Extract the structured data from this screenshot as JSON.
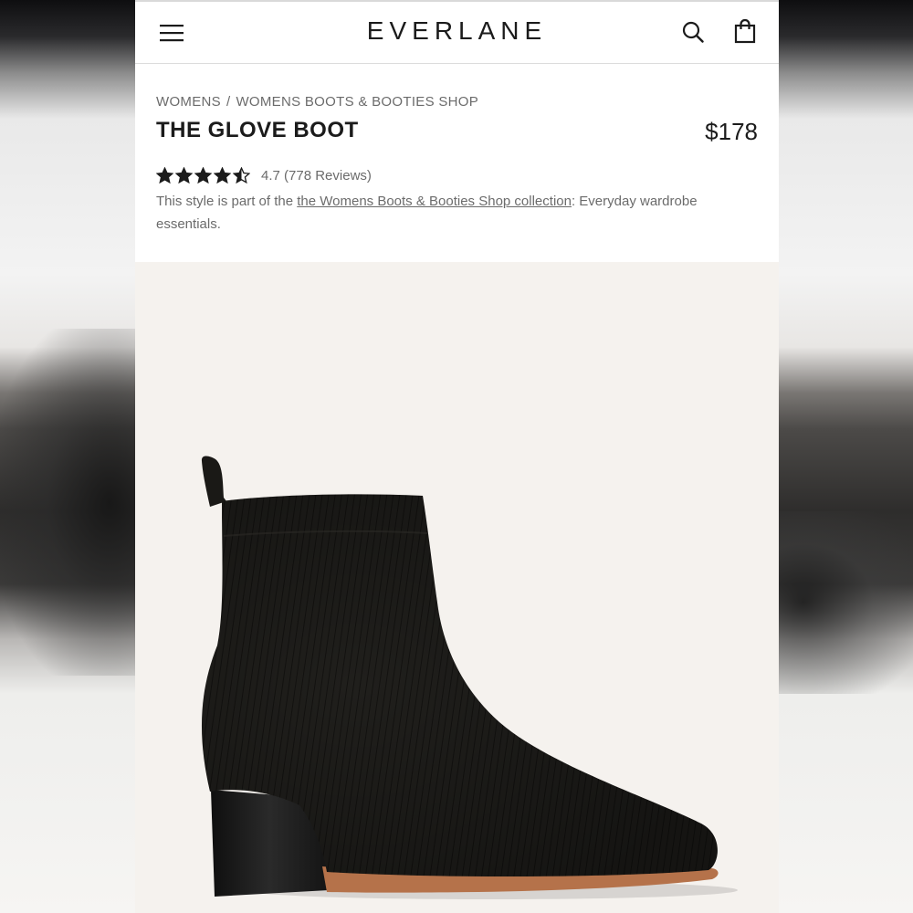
{
  "header": {
    "logo": "EVERLANE",
    "icons": [
      "menu-icon",
      "search-icon",
      "shopping-bag-icon"
    ]
  },
  "breadcrumb": {
    "items": [
      "WOMENS",
      "WOMENS BOOTS & BOOTIES SHOP"
    ],
    "separator": "/"
  },
  "product": {
    "title": "THE GLOVE BOOT",
    "price": "$178",
    "rating_value": 4.5,
    "rating_label": "4.7",
    "reviews_label": "(778 Reviews)",
    "desc_prefix": "This style is part of the ",
    "desc_link": "the Womens Boots & Booties Shop collection",
    "desc_suffix": ": Everyday wardrobe essentials.",
    "image_icon": "black-knit-ankle-boot"
  },
  "colors": {
    "text_primary": "#1b1b1b",
    "text_secondary": "#6b6b6b",
    "image_background": "#f5f2ee",
    "boot_knit": "#1f1e1b",
    "sole": "#b5724a"
  }
}
